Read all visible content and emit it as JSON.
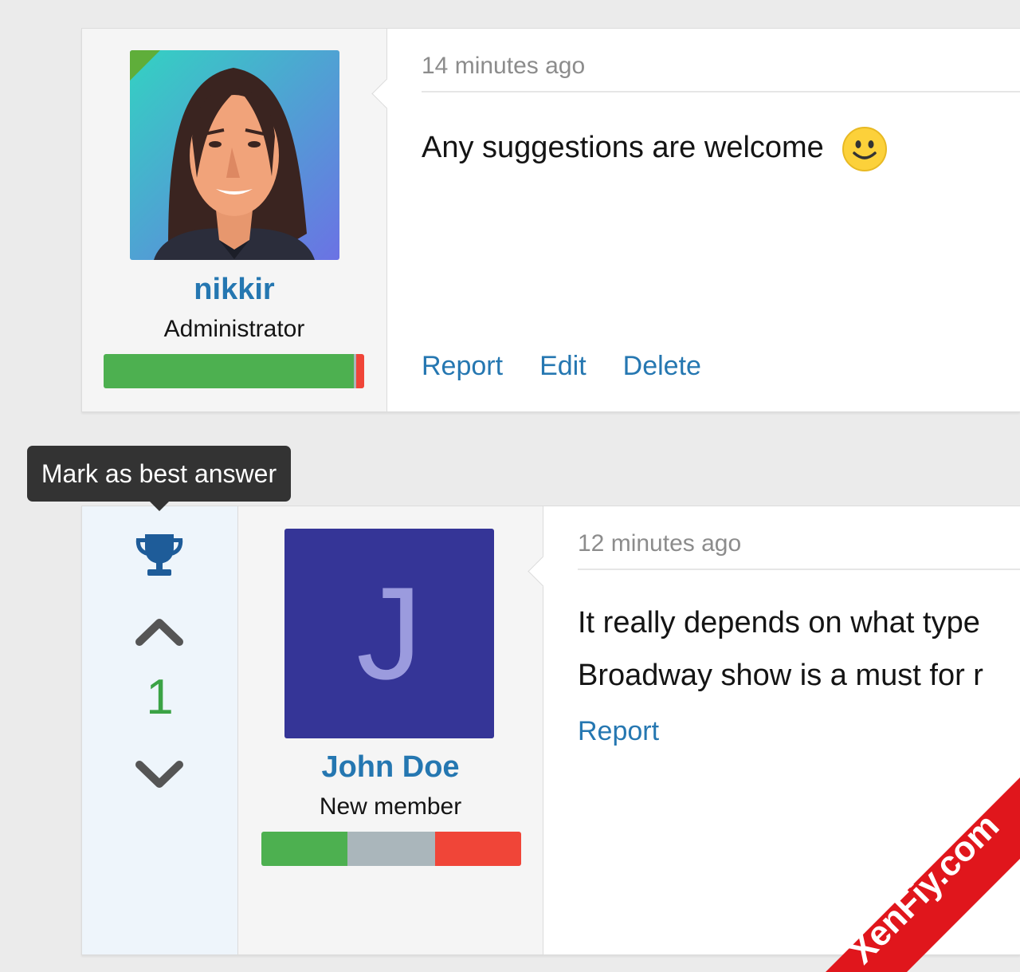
{
  "post1": {
    "username": "nikkir",
    "user_title": "Administrator",
    "time": "14 minutes ago",
    "message": "Any suggestions are welcome",
    "actions": {
      "report": "Report",
      "edit": "Edit",
      "delete": "Delete"
    },
    "reputation": {
      "positive": 0.96,
      "neutral": 0.01,
      "negative": 0.03
    }
  },
  "post2": {
    "avatar_letter": "J",
    "username": "John Doe",
    "user_title": "New member",
    "time": "12 minutes ago",
    "message_line1": "It really depends on what type",
    "message_line2": "Broadway show is a must for r",
    "actions": {
      "report": "Report"
    },
    "reputation": {
      "positive": 0.33,
      "neutral": 0.34,
      "negative": 0.33
    },
    "vote_score": "1"
  },
  "tooltip": {
    "text": "Mark as best answer"
  },
  "watermark": {
    "text": "XenFiy.com"
  },
  "colors": {
    "link": "#2577b1",
    "positive": "#4db050",
    "negative": "#f04538",
    "vote": "#3ba345",
    "watermark": "#e0161c"
  }
}
